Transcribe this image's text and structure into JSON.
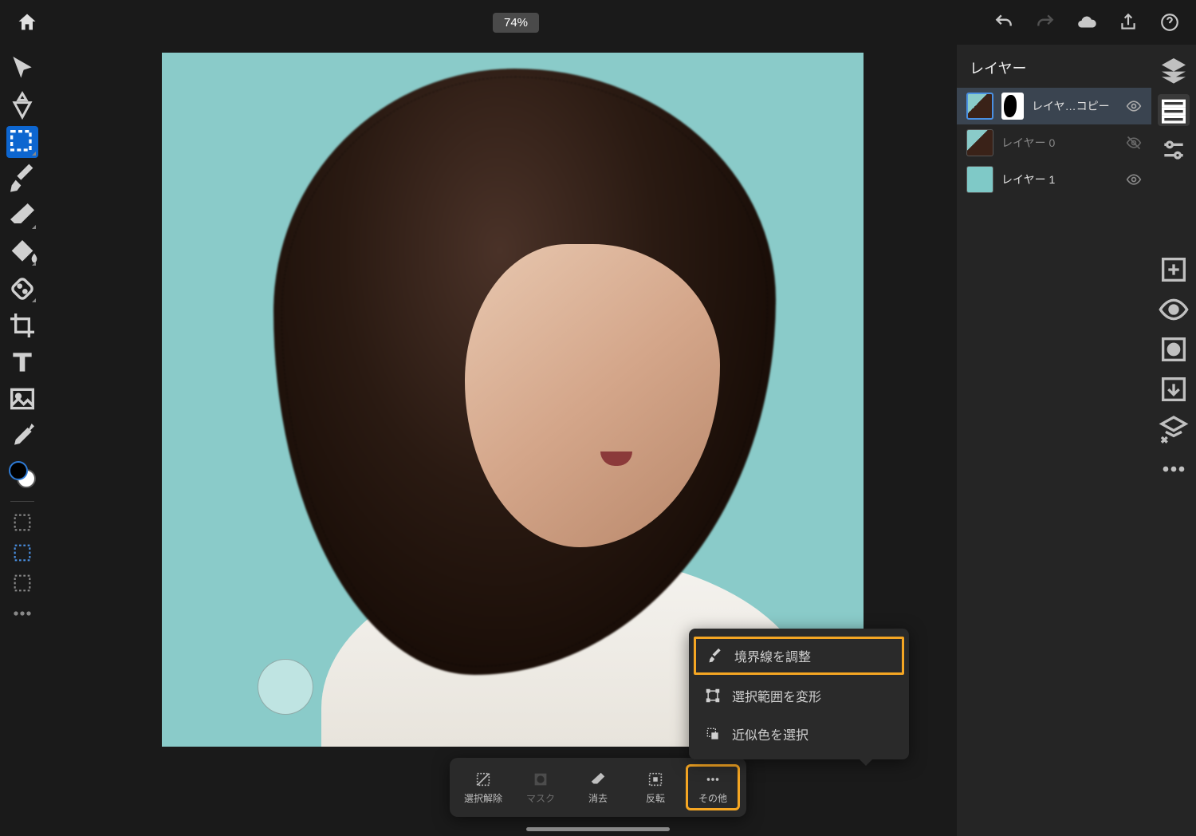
{
  "topbar": {
    "zoom": "74%"
  },
  "left_tools": [
    {
      "name": "move-tool"
    },
    {
      "name": "transform-tool"
    },
    {
      "name": "selection-tool",
      "active": true
    },
    {
      "name": "brush-tool"
    },
    {
      "name": "eraser-tool"
    },
    {
      "name": "fill-tool"
    },
    {
      "name": "healing-tool"
    },
    {
      "name": "crop-tool"
    },
    {
      "name": "type-tool"
    },
    {
      "name": "place-image-tool"
    },
    {
      "name": "eyedropper-tool"
    }
  ],
  "small_tools": [
    {
      "name": "rect-select-tool"
    },
    {
      "name": "lasso-tool"
    },
    {
      "name": "stamp-tool"
    },
    {
      "name": "more-tool"
    }
  ],
  "layers_panel": {
    "title": "レイヤー",
    "items": [
      {
        "name": "レイヤ…コピー",
        "selected": true,
        "has_mask": true,
        "visible": true,
        "thumb": "photo"
      },
      {
        "name": "レイヤー 0",
        "selected": false,
        "has_mask": false,
        "visible": false,
        "thumb": "photo"
      },
      {
        "name": "レイヤー 1",
        "selected": false,
        "has_mask": false,
        "visible": true,
        "thumb": "teal"
      }
    ]
  },
  "right_tools": [
    {
      "name": "layers-icon"
    },
    {
      "name": "layer-properties-icon",
      "active": true
    },
    {
      "name": "adjustments-icon"
    }
  ],
  "right_tools_lower": [
    {
      "name": "add-layer-icon"
    },
    {
      "name": "visibility-icon"
    },
    {
      "name": "mask-icon"
    },
    {
      "name": "export-icon"
    },
    {
      "name": "delete-icon"
    },
    {
      "name": "more-icon"
    }
  ],
  "bottom_bar": {
    "items": [
      {
        "label": "選択解除",
        "name": "deselect-button"
      },
      {
        "label": "マスク",
        "name": "mask-button",
        "dim": true
      },
      {
        "label": "消去",
        "name": "erase-button"
      },
      {
        "label": "反転",
        "name": "invert-button"
      },
      {
        "label": "その他",
        "name": "more-button",
        "highlight": true
      }
    ]
  },
  "popup": {
    "items": [
      {
        "label": "境界線を調整",
        "name": "refine-edge-item",
        "highlight": true
      },
      {
        "label": "選択範囲を変形",
        "name": "transform-selection-item"
      },
      {
        "label": "近似色を選択",
        "name": "select-similar-item"
      }
    ]
  }
}
